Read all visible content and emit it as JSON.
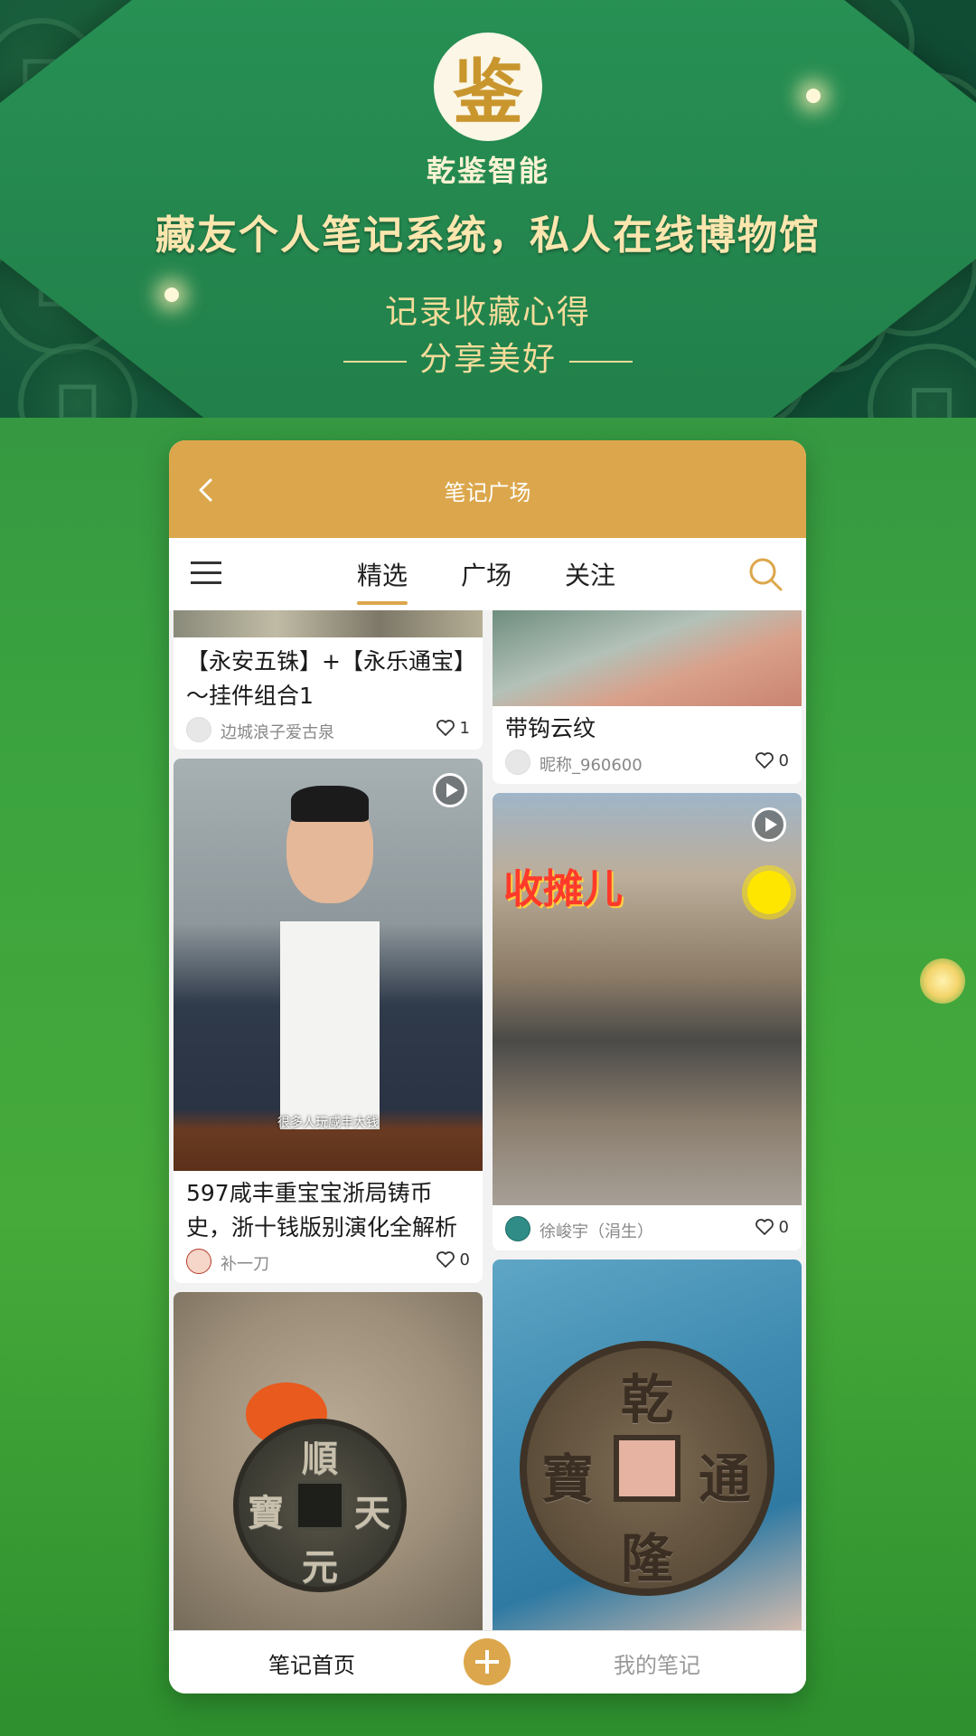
{
  "banner": {
    "logo_char": "鉴",
    "brand": "乾鉴智能",
    "headline": "藏友个人笔记系统，私人在线博物馆",
    "subtitle1": "记录收藏心得",
    "subtitle2": "分享美好"
  },
  "colors": {
    "accent": "#dca74c",
    "green_bg": "#3aa23f",
    "banner_green": "#23854d"
  },
  "appbar": {
    "title": "笔记广场"
  },
  "tabs": [
    {
      "label": "精选",
      "active": true
    },
    {
      "label": "广场",
      "active": false
    },
    {
      "label": "关注",
      "active": false
    }
  ],
  "cards": [
    {
      "title": "【永安五铢】+【永乐通宝】～挂件组合1",
      "author": "边城浪子爱古泉",
      "likes": "1",
      "video": false
    },
    {
      "title": "带钩云纹",
      "author": "昵称_960600",
      "likes": "0",
      "video": false
    },
    {
      "title": "597咸丰重宝宝浙局铸币史，浙十钱版别演化全解析",
      "author": "补一刀",
      "likes": "0",
      "video": true,
      "overlay": "很多人玩咸丰大钱"
    },
    {
      "title": "",
      "author": "徐峻宇（涓生）",
      "likes": "0",
      "video": true,
      "overlay": "收摊儿"
    },
    {
      "title": "",
      "author": "",
      "likes": "",
      "video": false,
      "coin_chars": [
        "順",
        "天",
        "元",
        "寶"
      ]
    },
    {
      "title": "",
      "author": "",
      "likes": "",
      "video": false,
      "coin_chars": [
        "乾",
        "通",
        "隆",
        "寶"
      ]
    }
  ],
  "bottom_nav": {
    "home": "笔记首页",
    "mine": "我的笔记"
  },
  "icons": {
    "back": "chevron-left-icon",
    "menu": "hamburger-menu-icon",
    "search": "search-icon",
    "heart": "heart-icon",
    "play": "play-icon",
    "add": "plus-icon"
  }
}
